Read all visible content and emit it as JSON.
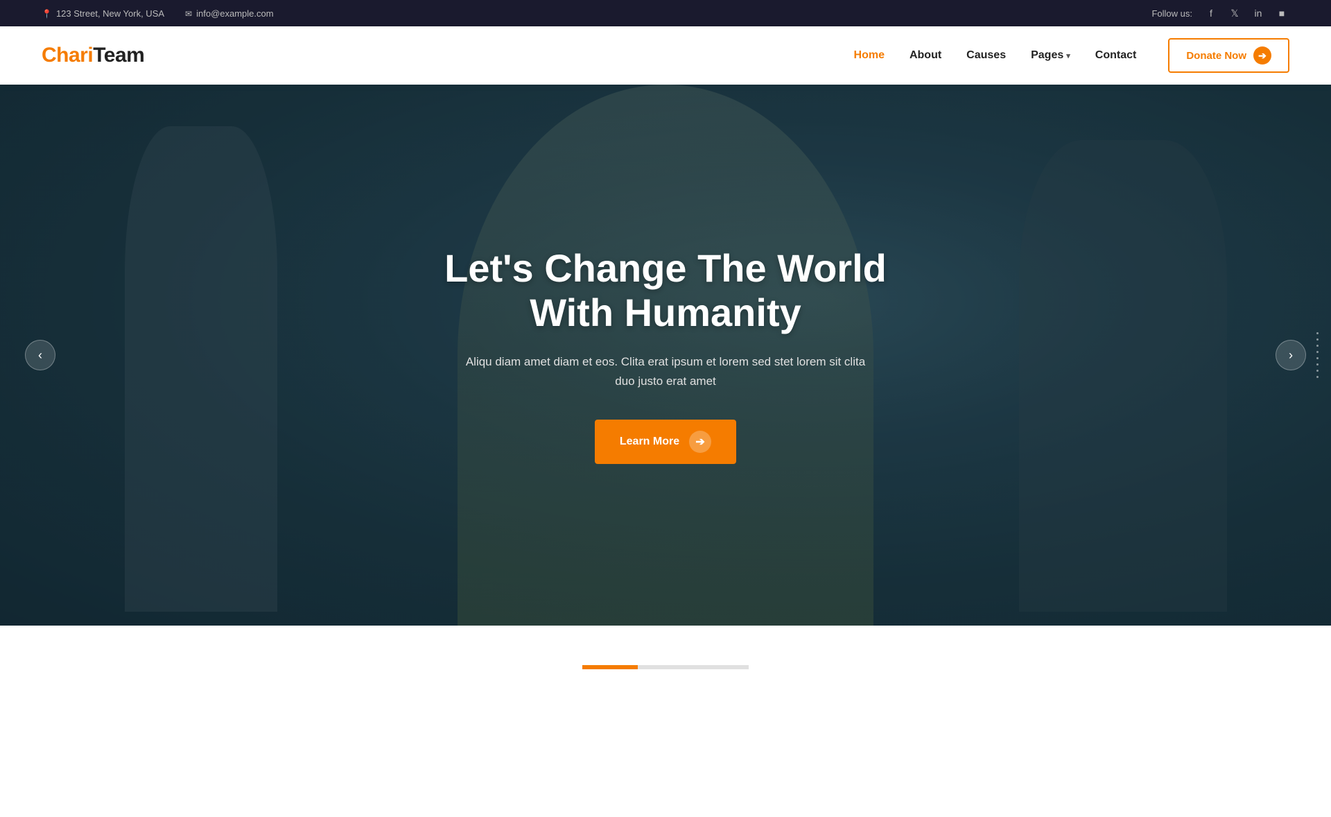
{
  "topbar": {
    "address": "123 Street, New York, USA",
    "email": "info@example.com",
    "follow_label": "Follow us:",
    "social_links": [
      "facebook",
      "twitter",
      "linkedin",
      "instagram"
    ]
  },
  "header": {
    "logo_chari": "Chari",
    "logo_team": "Team",
    "nav_items": [
      {
        "label": "Home",
        "active": true
      },
      {
        "label": "About"
      },
      {
        "label": "Causes"
      },
      {
        "label": "Pages",
        "has_dropdown": true
      },
      {
        "label": "Contact"
      }
    ],
    "donate_btn": "Donate Now"
  },
  "hero": {
    "title": "Let's Change The World\nWith Humanity",
    "subtitle": "Aliqu diam amet diam et eos. Clita erat ipsum et lorem sed stet lorem sit clita\nduo justo erat amet",
    "cta_label": "Learn More",
    "slider_prev": "‹",
    "slider_next": "›"
  },
  "bottom": {
    "strips": [
      "active",
      "inactive",
      "inactive"
    ]
  }
}
